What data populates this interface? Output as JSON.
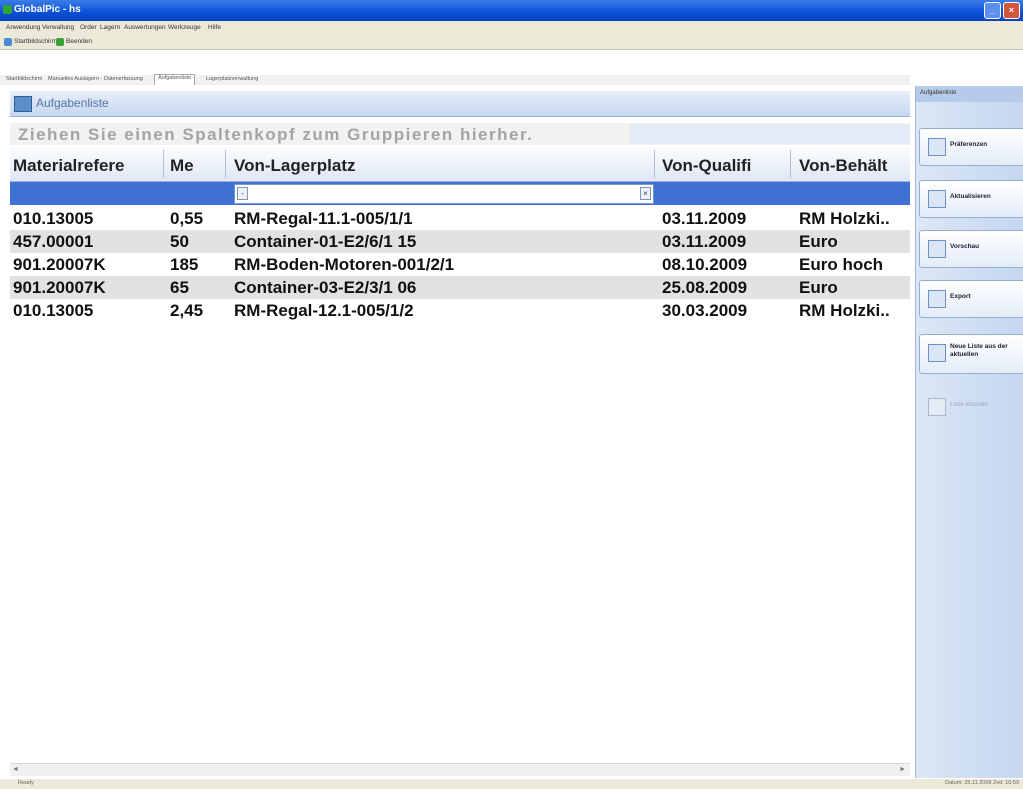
{
  "window": {
    "title": "GlobalPic - hs"
  },
  "menu": [
    "Anwendung",
    "Verwaltung",
    "Order",
    "Lagern",
    "Auswertungen",
    "Werkzeuge",
    "Hilfe"
  ],
  "toolbar": {
    "start": "Startbildschirm",
    "exit": "Beenden"
  },
  "tabs": [
    "Startbildschirm",
    "Manuelles Auslagern - Datenerfassung",
    "Aufgabenliste",
    "Lagerplatzverwaltung"
  ],
  "panel": {
    "title": "Aufgabenliste"
  },
  "grid": {
    "group_hint": "Ziehen Sie einen Spaltenkopf zum Gruppieren hierher.",
    "columns": [
      "Materialrefere",
      "Me",
      "Von-Lagerplatz",
      "Von-Qualifi",
      "Von-Behält"
    ],
    "rows": [
      [
        "010.13005",
        "0,55",
        "RM-Regal-11.1-005/1/1",
        "03.11.2009",
        "RM Holzki.."
      ],
      [
        "457.00001",
        "50",
        "Container-01-E2/6/1 15",
        "03.11.2009",
        "Euro"
      ],
      [
        "901.20007K",
        "185",
        "RM-Boden-Motoren-001/2/1",
        "08.10.2009",
        "Euro hoch"
      ],
      [
        "901.20007K",
        "65",
        "Container-03-E2/3/1 06",
        "25.08.2009",
        "Euro"
      ],
      [
        "010.13005",
        "2,45",
        "RM-Regal-12.1-005/1/2",
        "30.03.2009",
        "RM Holzki.."
      ]
    ]
  },
  "side": {
    "title": "Aufgabenliste",
    "buttons": [
      "Präferenzen",
      "Aktualisieren",
      "Vorschau",
      "Export",
      "Neue Liste aus der aktuellen",
      "Liste löschen"
    ]
  },
  "status": {
    "left": "Ready",
    "right": "Datum: 25.11.2009 Zeit: 10:59"
  }
}
